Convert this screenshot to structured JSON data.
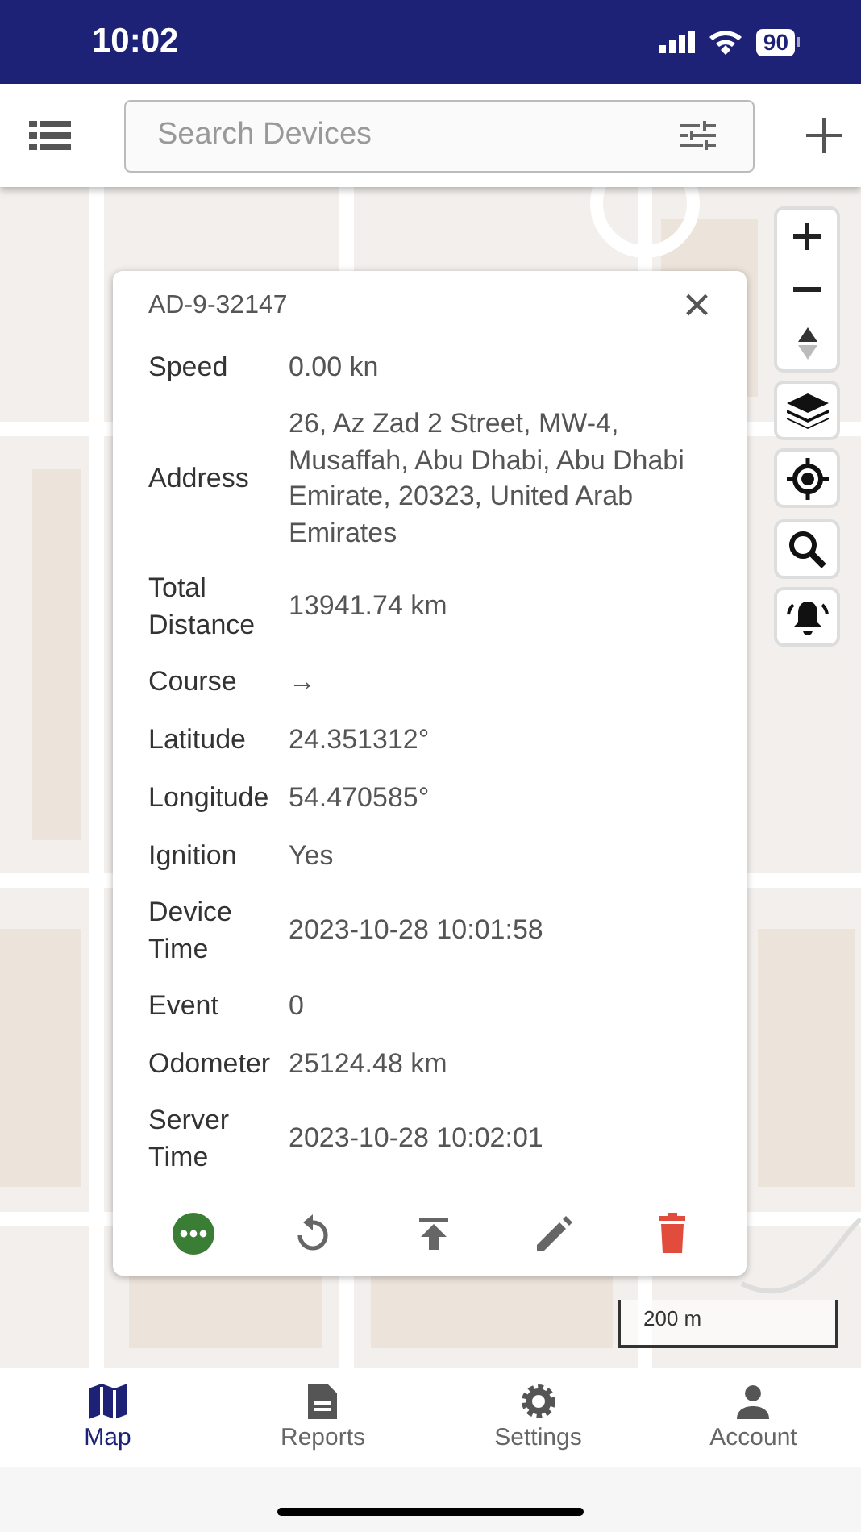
{
  "status_bar": {
    "time": "10:02",
    "battery": "90"
  },
  "toolbar": {
    "search": {
      "placeholder": "Search Devices"
    }
  },
  "map": {
    "scale": "200 m"
  },
  "popup": {
    "title": "AD-9-32147",
    "close": "×",
    "rows": [
      {
        "label": "Speed",
        "value": "0.00 kn"
      },
      {
        "label": "Address",
        "value": "26, Az Zad 2 Street, MW-4, Musaffah, Abu Dhabi, Abu Dhabi Emirate, 20323, United Arab Emirates"
      },
      {
        "label": "Total Distance",
        "value": "13941.74 km"
      },
      {
        "label": "Course",
        "value": "→"
      },
      {
        "label": "Latitude",
        "value": "24.351312°"
      },
      {
        "label": "Longitude",
        "value": "54.470585°"
      },
      {
        "label": "Ignition",
        "value": "Yes"
      },
      {
        "label": "Device Time",
        "value": "2023-10-28 10:01:58"
      },
      {
        "label": "Event",
        "value": "0"
      },
      {
        "label": "Odometer",
        "value": "25124.48 km"
      },
      {
        "label": "Server Time",
        "value": "2023-10-28 10:02:01"
      }
    ],
    "actions": [
      {
        "kind": "more"
      },
      {
        "kind": "replay"
      },
      {
        "kind": "upload"
      },
      {
        "kind": "edit"
      },
      {
        "kind": "delete"
      }
    ]
  },
  "bottom_nav": [
    {
      "label": "Map",
      "kind": "map",
      "selected": true
    },
    {
      "label": "Reports",
      "kind": "reports",
      "selected": false
    },
    {
      "label": "Settings",
      "kind": "settings",
      "selected": false
    },
    {
      "label": "Account",
      "kind": "account",
      "selected": false
    }
  ]
}
